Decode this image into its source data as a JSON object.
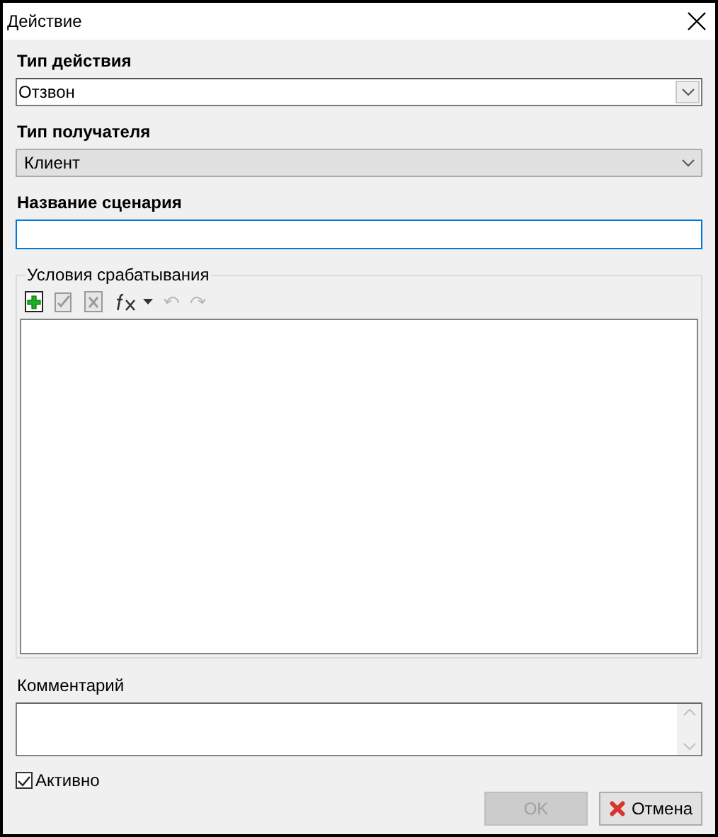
{
  "window": {
    "title": "Действие"
  },
  "action_type": {
    "label": "Тип действия",
    "value": "Отзвон"
  },
  "recipient_type": {
    "label": "Тип получателя",
    "value": "Клиент"
  },
  "scenario_name": {
    "label": "Название сценария",
    "focused": true
  },
  "conditions": {
    "title": "Условия срабатывания",
    "toolbar": [
      {
        "kind": "add",
        "disabled": false
      },
      {
        "kind": "edit",
        "disabled": true
      },
      {
        "kind": "delete",
        "disabled": true
      },
      {
        "kind": "function",
        "disabled": false
      },
      {
        "kind": "undo",
        "disabled": true
      },
      {
        "kind": "redo",
        "disabled": true
      }
    ]
  },
  "comment": {
    "label": "Комментарий"
  },
  "active": {
    "label": "Активно",
    "checked": true
  },
  "buttons": [
    {
      "kind": "ok",
      "label": "OK",
      "disabled": true
    },
    {
      "kind": "cancel",
      "label": "Отмена",
      "disabled": false
    }
  ]
}
